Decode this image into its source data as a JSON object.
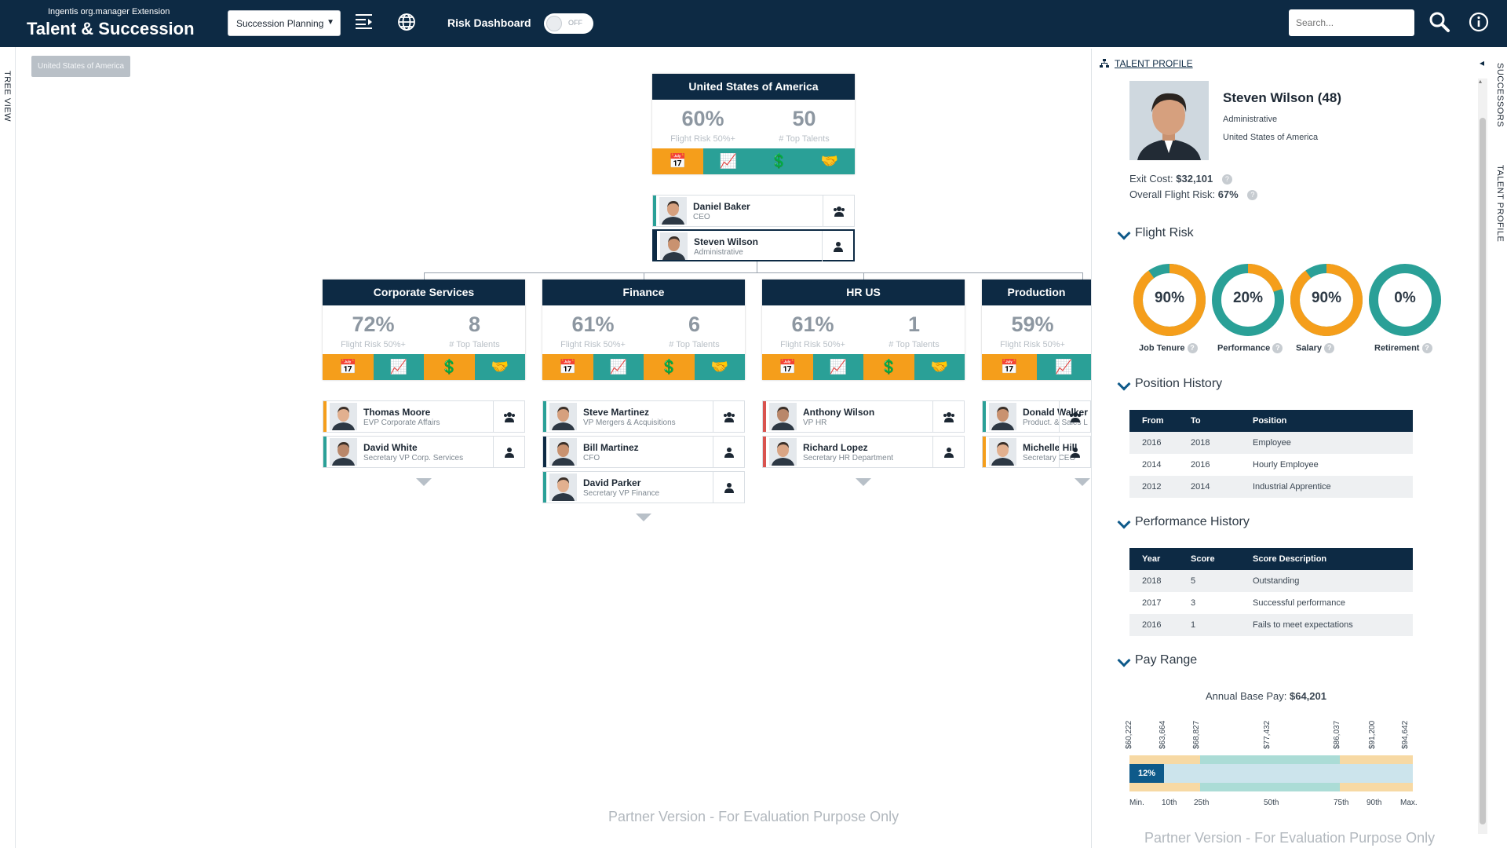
{
  "header": {
    "brand_subtitle": "Ingentis org.manager Extension",
    "brand_title": "Talent & Succession",
    "view_select": "Succession Planning",
    "risk_label": "Risk Dashboard",
    "toggle_state": "OFF",
    "search_placeholder": "Search..."
  },
  "left_strip": {
    "label": "TREE VIEW"
  },
  "breadcrumb": "United States of America",
  "root": {
    "title": "United States of America",
    "stat1_value": "60%",
    "stat1_label": "Flight Risk 50%+",
    "stat2_value": "50",
    "stat2_label": "# Top Talents",
    "people": [
      {
        "name": "Daniel Baker",
        "title": "CEO"
      },
      {
        "name": "Steven Wilson",
        "title": "Administrative"
      }
    ]
  },
  "units": [
    {
      "title": "Corporate Services",
      "stat1_value": "72%",
      "stat1_label": "Flight Risk 50%+",
      "stat2_value": "8",
      "stat2_label": "# Top Talents",
      "people": [
        {
          "name": "Thomas Moore",
          "title": "EVP Corporate Affairs"
        },
        {
          "name": "David White",
          "title": "Secretary VP Corp. Services"
        }
      ]
    },
    {
      "title": "Finance",
      "stat1_value": "61%",
      "stat1_label": "Flight Risk 50%+",
      "stat2_value": "6",
      "stat2_label": "# Top Talents",
      "people": [
        {
          "name": "Steve Martinez",
          "title": "VP Mergers & Acquisitions"
        },
        {
          "name": "Bill Martinez",
          "title": "CFO"
        },
        {
          "name": "David Parker",
          "title": "Secretary VP Finance"
        }
      ]
    },
    {
      "title": "HR US",
      "stat1_value": "61%",
      "stat1_label": "Flight Risk 50%+",
      "stat2_value": "1",
      "stat2_label": "# Top Talents",
      "people": [
        {
          "name": "Anthony Wilson",
          "title": "VP HR"
        },
        {
          "name": "Richard Lopez",
          "title": "Secretary HR Department"
        }
      ]
    },
    {
      "title": "Production",
      "stat1_value": "59%",
      "stat1_label": "Flight Risk 50%+",
      "stat2_value": "",
      "stat2_label": "",
      "people": [
        {
          "name": "Donald Walker",
          "title": "Product. & Sales L"
        },
        {
          "name": "Michelle Hill",
          "title": "Secretary CEO"
        }
      ]
    }
  ],
  "watermark": "Partner Version - For Evaluation Purpose Only",
  "profile": {
    "panel_title": "TALENT PROFILE",
    "name": "Steven Wilson (48)",
    "department": "Administrative",
    "country": "United States of America",
    "exit_cost_label": "Exit Cost:",
    "exit_cost_value": "$32,101",
    "flight_risk_label": "Overall Flight Risk:",
    "flight_risk_value": "67%",
    "flight_risk_section": "Flight Risk",
    "donuts": [
      {
        "label": "Job Tenure",
        "value": "90%",
        "pct": 90,
        "color": "#f59e1b"
      },
      {
        "label": "Performance",
        "value": "20%",
        "pct": 20,
        "color": "#f59e1b"
      },
      {
        "label": "Salary",
        "value": "90%",
        "pct": 90,
        "color": "#f59e1b"
      },
      {
        "label": "Retirement",
        "value": "0%",
        "pct": 0,
        "color": "#f59e1b"
      }
    ],
    "position_history_section": "Position History",
    "position_headers": [
      "From",
      "To",
      "Position"
    ],
    "position_rows": [
      [
        "2016",
        "2018",
        "Employee"
      ],
      [
        "2014",
        "2016",
        "Hourly Employee"
      ],
      [
        "2012",
        "2014",
        "Industrial Apprentice"
      ]
    ],
    "performance_history_section": "Performance History",
    "performance_headers": [
      "Year",
      "Score",
      "Score Description"
    ],
    "performance_rows": [
      [
        "2018",
        "5",
        "Outstanding"
      ],
      [
        "2017",
        "3",
        "Successful performance"
      ],
      [
        "2016",
        "1",
        "Fails to meet expectations"
      ]
    ],
    "pay_range_section": "Pay Range",
    "annual_label": "Annual Base Pay:",
    "annual_value": "$64,201",
    "pay_ticks": [
      "$60,222",
      "$63,664",
      "$68,827",
      "$77,432",
      "$86,037",
      "$91,200",
      "$94,642"
    ],
    "pay_positions": [
      "Min.",
      "10th",
      "25th",
      "50th",
      "75th",
      "90th",
      "Max."
    ],
    "pay_marker": "12%",
    "watermark": "Partner Version - For Evaluation Purpose Only"
  },
  "right_strip": {
    "successors": "SUCCESSORS",
    "talent_profile": "TALENT PROFILE"
  }
}
